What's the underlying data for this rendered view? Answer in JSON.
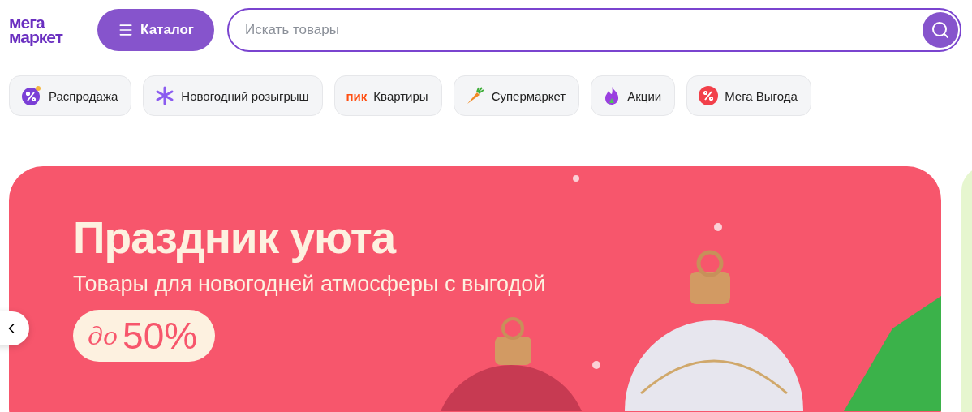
{
  "logo": {
    "line_1": "мега",
    "line_2": "маркет"
  },
  "catalog_button": {
    "label": "Каталог"
  },
  "search": {
    "placeholder": "Искать товары"
  },
  "chips": [
    {
      "kind": "sale",
      "label": "Распродажа"
    },
    {
      "kind": "snowflake",
      "label": "Новогодний розыгрыш"
    },
    {
      "kind": "brand",
      "brand_text": "пик",
      "label": "Квартиры"
    },
    {
      "kind": "carrot",
      "label": "Супермаркет"
    },
    {
      "kind": "fire",
      "label": "Акции"
    },
    {
      "kind": "percent",
      "label": "Мега Выгода"
    }
  ],
  "banner": {
    "title": "Праздник уюта",
    "subtitle": "Товары для новогодней атмосферы с выгодой",
    "discount_prefix": "до",
    "discount": "50%"
  }
}
